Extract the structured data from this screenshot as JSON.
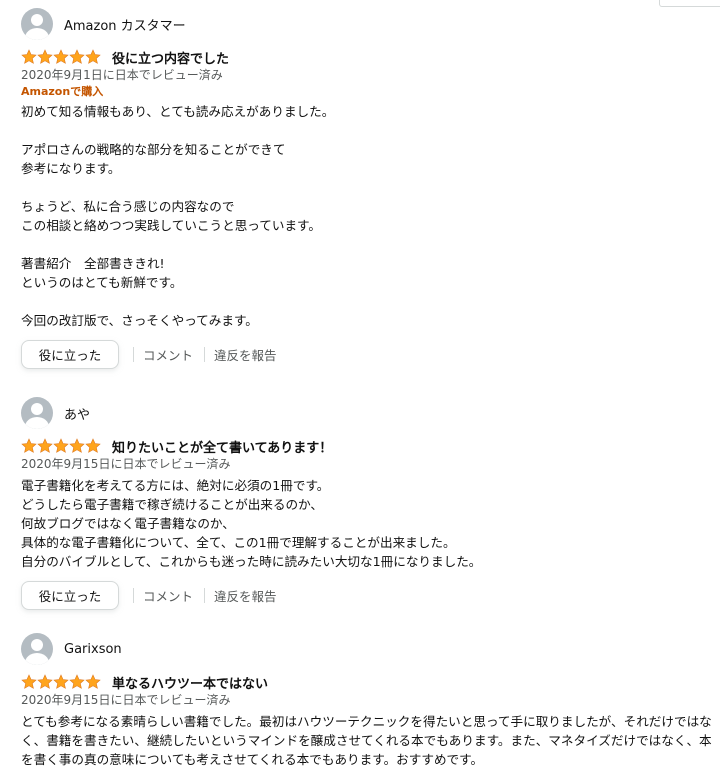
{
  "reviews": [
    {
      "reviewer": "Amazon カスタマー",
      "rating": 5,
      "title": "役に立つ内容でした",
      "date": "2020年9月1日に日本でレビュー済み",
      "badge": "Amazonで購入",
      "body": "初めて知る情報もあり、とても読み応えがありました。\n\nアポロさんの戦略的な部分を知ることができて\n参考になります。\n\nちょうど、私に合う感じの内容なので\nこの相談と絡めつつ実践していこうと思っています。\n\n著書紹介　全部書ききれ!\nというのはとても新鮮です。\n\n今回の改訂版で、さっそくやってみます。",
      "helpful_label": "役に立った",
      "comment_label": "コメント",
      "report_label": "違反を報告"
    },
    {
      "reviewer": "あや",
      "rating": 5,
      "title": "知りたいことが全て書いてあります！",
      "date": "2020年9月15日に日本でレビュー済み",
      "body": "電子書籍化を考えてる方には、絶対に必須の1冊です。\nどうしたら電子書籍で稼ぎ続けることが出来るのか、\n何故ブログではなく電子書籍なのか、\n具体的な電子書籍化について、全て、この1冊で理解することが出来ました。\n自分のバイブルとして、これからも迷った時に読みたい大切な1冊になりました。",
      "helpful_label": "役に立った",
      "comment_label": "コメント",
      "report_label": "違反を報告"
    },
    {
      "reviewer": "Garixson",
      "rating": 5,
      "title": "単なるハウツー本ではない",
      "date": "2020年9月15日に日本でレビュー済み",
      "body": "とても参考になる素晴らしい書籍でした。最初はハウツーテクニックを得たいと思って手に取りましたが、それだけではなく、書籍を書きたい、継続したいというマインドを醸成させてくれる本でもあります。また、マネタイズだけではなく、本を書く事の真の意味についても考えさせてくれる本でもあります。おすすめです。"
    }
  ],
  "colors": {
    "star": "#ffa41c",
    "badge": "#c45500",
    "muted": "#565959"
  },
  "icons": {
    "star": "star-icon",
    "avatar": "default-avatar-icon"
  }
}
